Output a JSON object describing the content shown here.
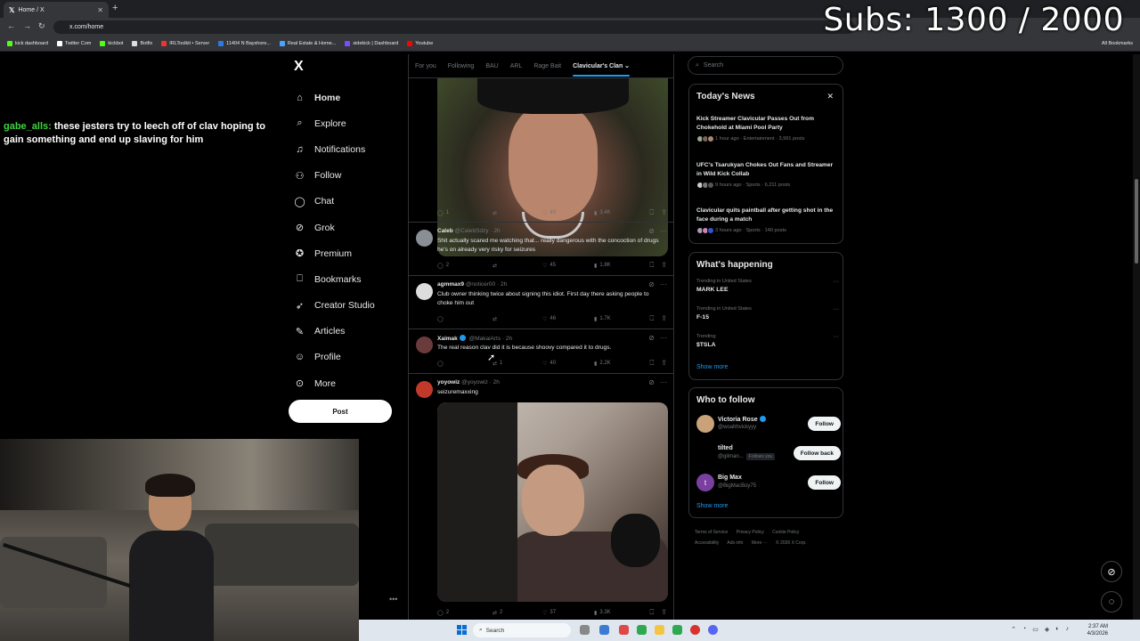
{
  "browser": {
    "tab_title": "Home / X",
    "url": "x.com/home",
    "bookmarks": [
      "kick dashboard",
      "Twitter Com",
      "kickbot",
      "Botfix",
      "IRLToolkit • Server",
      "11404 N Bayshore...",
      "Real Estate & Home...",
      "sidekick | Dashboard",
      "Youtube"
    ],
    "all_bookmarks": "All Bookmarks"
  },
  "overlay": {
    "subs": "Subs: 1300 / 2000",
    "chat_user": "gabe_alls:",
    "chat_message": "these jesters try to leech off of clav hoping to gain something and end up slaving for him"
  },
  "nav": {
    "logo": "X",
    "items": [
      "Home",
      "Explore",
      "Notifications",
      "Follow",
      "Chat",
      "Grok",
      "Premium",
      "Bookmarks",
      "Creator Studio",
      "Articles",
      "Profile",
      "More"
    ],
    "post": "Post"
  },
  "feed": {
    "tabs": [
      "For you",
      "Following",
      "BAU",
      "ARL",
      "Rage Bait",
      "Clavicular's Clan"
    ],
    "first_actions": {
      "replies": "1",
      "reposts": "",
      "likes": "49",
      "views": "3.4K"
    },
    "tweets": [
      {
        "name": "Caleb",
        "handle": "@CalebSdzy · 2h",
        "text": "Shit actually scared me watching that... really dangerous with the concoction of drugs he's on already very risky for seizures",
        "replies": "2",
        "reposts": "",
        "likes": "45",
        "views": "1.8K"
      },
      {
        "name": "agmmax9",
        "handle": "@noticer00 · 2h",
        "text": "Club owner thinking twice about signing this idiot. First day there asking people to choke him out",
        "replies": "",
        "reposts": "",
        "likes": "46",
        "views": "1.7K"
      },
      {
        "name": "Xaimak",
        "handle": "@MakaiArts · 2h",
        "text": "The real reason clav did it is because shoovy compared it to drugs.",
        "replies": "",
        "reposts": "1",
        "likes": "40",
        "views": "2.2K"
      },
      {
        "name": "yoyowiz",
        "handle": "@yoyowiz · 2h",
        "text": "seizuremaxxing",
        "replies": "2",
        "reposts": "2",
        "likes": "37",
        "views": "3.3K"
      }
    ]
  },
  "sidebar": {
    "search_placeholder": "Search",
    "news_title": "Today's News",
    "news": [
      {
        "title": "Kick Streamer Clavicular Passes Out from Chokehold at Miami Pool Party",
        "meta": "1 hour ago · Entertainment · 3,991 posts"
      },
      {
        "title": "UFC's Tsarukyan Chokes Out Fans and Streamer in Wild Kick Collab",
        "meta": "9 hours ago · Sports · 6,211 posts"
      },
      {
        "title": "Clavicular quits paintball after getting shot in the face during a match",
        "meta": "3 hours ago · Sports · 140 posts"
      }
    ],
    "happening_title": "What's happening",
    "trends": [
      {
        "context": "Trending in United States",
        "name": "MARK LEE"
      },
      {
        "context": "Trending in United States",
        "name": "F-15"
      },
      {
        "context": "Trending",
        "name": "$TSLA"
      }
    ],
    "show_more": "Show more",
    "wtf_title": "Who to follow",
    "wtf": [
      {
        "name": "Victoria Rose",
        "handle": "@woahhvickyyy",
        "button": "Follow",
        "follows_you": ""
      },
      {
        "name": "tilted",
        "handle": "@gilman...",
        "button": "Follow back",
        "follows_you": "Follows you"
      },
      {
        "name": "Big Max",
        "handle": "@BigMacBoy75",
        "button": "Follow",
        "follows_you": ""
      }
    ],
    "footer": [
      "Terms of Service",
      "Privacy Policy",
      "Cookie Policy",
      "Accessibility",
      "Ads info",
      "More ···",
      "© 2026 X Corp."
    ]
  },
  "taskbar": {
    "search": "Search",
    "time": "2:37 AM",
    "date": "4/3/2026"
  },
  "colors": {
    "accent": "#1d9bf0",
    "chat_user": "#3fd33f"
  }
}
